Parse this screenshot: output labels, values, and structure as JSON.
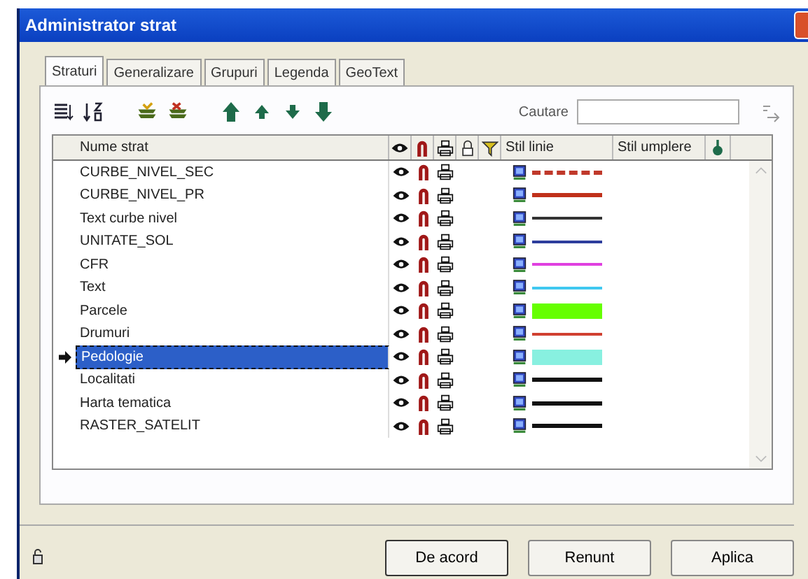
{
  "window": {
    "title": "Administrator strat"
  },
  "tabs": [
    {
      "label": "Straturi",
      "selected": true
    },
    {
      "label": "Generalizare",
      "selected": false
    },
    {
      "label": "Grupuri",
      "selected": false
    },
    {
      "label": "Legenda",
      "selected": false
    },
    {
      "label": "GeoText",
      "selected": false
    }
  ],
  "search": {
    "label": "Cautare"
  },
  "table": {
    "columns": [
      "Nume strat",
      "Stil linie",
      "Stil umplere"
    ],
    "rows": [
      {
        "name": "CURBE_NIVEL_SEC",
        "selected": false,
        "line": {
          "kind": "dashed",
          "color": "#c0392b"
        }
      },
      {
        "name": "CURBE_NIVEL_PR",
        "selected": false,
        "line": {
          "kind": "thick",
          "color": "#c0301a"
        }
      },
      {
        "name": "Text curbe nivel",
        "selected": false,
        "line": {
          "kind": "solid",
          "color": "#333333"
        }
      },
      {
        "name": "UNITATE_SOL",
        "selected": false,
        "line": {
          "kind": "solid",
          "color": "#2d3e9c"
        }
      },
      {
        "name": "CFR",
        "selected": false,
        "line": {
          "kind": "solid",
          "color": "#e040e0"
        }
      },
      {
        "name": "Text",
        "selected": false,
        "line": {
          "kind": "solid",
          "color": "#40c8f0"
        }
      },
      {
        "name": "Parcele",
        "selected": false,
        "line": {
          "kind": "band",
          "color": "#66ff00"
        }
      },
      {
        "name": "Drumuri",
        "selected": false,
        "line": {
          "kind": "solid",
          "color": "#d04030"
        }
      },
      {
        "name": "Pedologie",
        "selected": true,
        "line": {
          "kind": "band",
          "color": "#88f0e0"
        }
      },
      {
        "name": "Localitati",
        "selected": false,
        "line": {
          "kind": "thick",
          "color": "#111111"
        }
      },
      {
        "name": "Harta tematica",
        "selected": false,
        "line": {
          "kind": "thick",
          "color": "#111111"
        }
      },
      {
        "name": "RASTER_SATELIT",
        "selected": false,
        "line": {
          "kind": "thick",
          "color": "#111111"
        }
      }
    ]
  },
  "buttons": [
    "De acord",
    "Renunt",
    "Aplica"
  ]
}
